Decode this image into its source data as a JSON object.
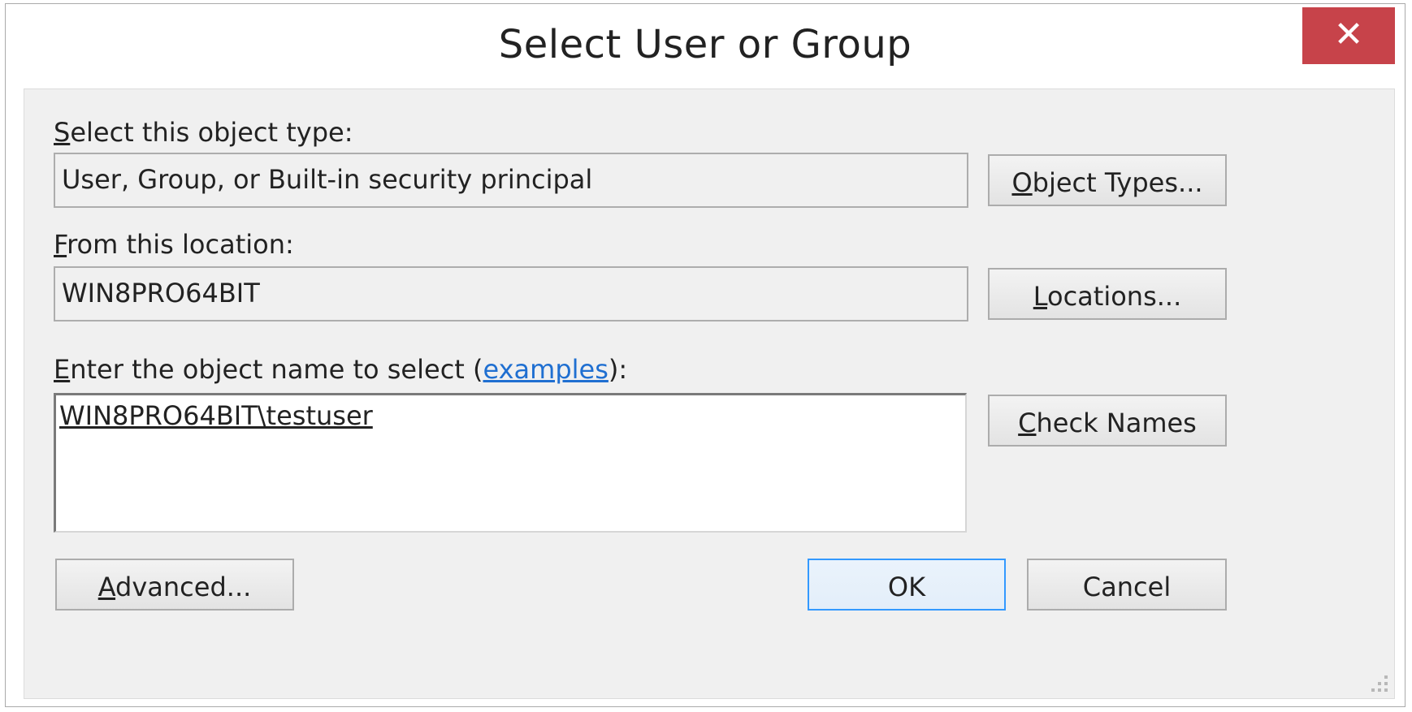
{
  "window": {
    "title": "Select User or Group",
    "close_glyph": "✕"
  },
  "object_type": {
    "label_accel": "S",
    "label_rest": "elect this object type:",
    "value": "User, Group, or Built-in security principal",
    "button_accel": "O",
    "button_rest": "bject Types..."
  },
  "location": {
    "label_accel": "F",
    "label_rest": "rom this location:",
    "value": "WIN8PRO64BIT",
    "button_accel": "L",
    "button_rest": "ocations..."
  },
  "object_name": {
    "label_accel": "E",
    "label_rest": "nter the object name to select (",
    "link_text": "examples",
    "label_suffix": "):",
    "value": "WIN8PRO64BIT\\testuser",
    "button_accel": "C",
    "button_rest": "heck Names"
  },
  "footer": {
    "advanced_accel": "A",
    "advanced_rest": "dvanced...",
    "ok_label": "OK",
    "cancel_label": "Cancel"
  },
  "colors": {
    "close_button_bg": "#c7434a",
    "default_button_border": "#3399ff",
    "link": "#1f6fd1",
    "client_bg": "#f0f0f0"
  },
  "icons": {
    "close": "close-icon",
    "resize_grip": "resize-grip-icon"
  }
}
